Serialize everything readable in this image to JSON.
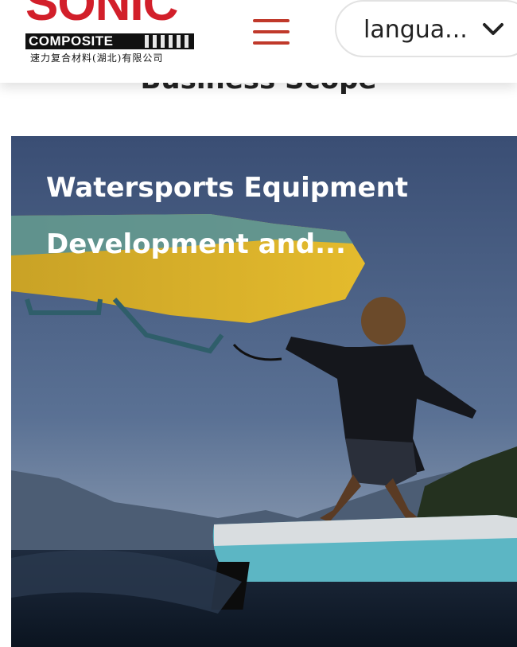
{
  "header": {
    "logo": {
      "brand": "SONIC",
      "sub_brand": "COMPOSITE",
      "chinese_name": "速力复合材料(湖北)有限公司"
    },
    "menu_icon": "hamburger-menu-icon",
    "language_selector": {
      "label": "langua...",
      "icon": "chevron-down-icon"
    }
  },
  "section": {
    "title": "Business Scope"
  },
  "card": {
    "title_line1": "Watersports Equipment",
    "title_line2": "Development and..."
  },
  "colors": {
    "brand_red": "#d21f2a",
    "menu_red": "#c0392b"
  }
}
